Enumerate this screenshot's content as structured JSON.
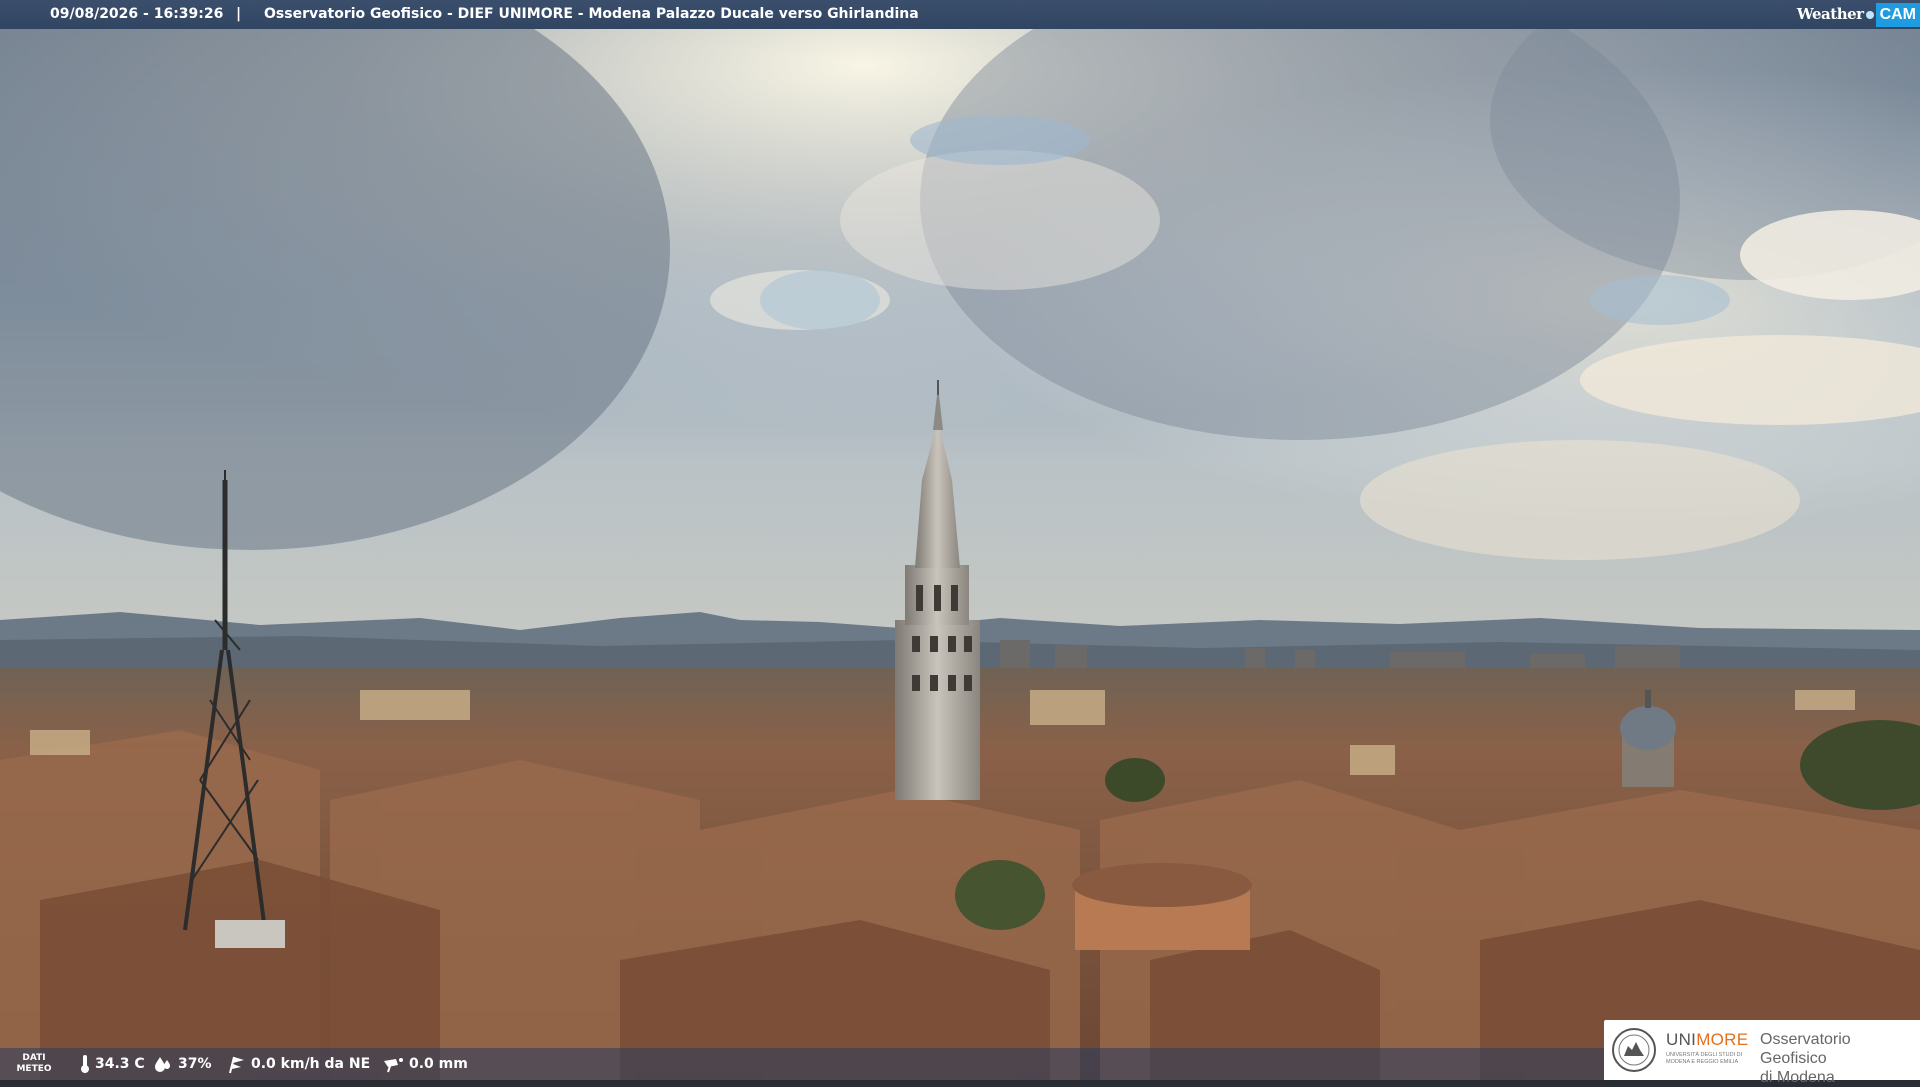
{
  "header": {
    "timestamp": "09/08/2026 - 16:39:26",
    "separator": "|",
    "title": "Osservatorio Geofisico - DIEF UNIMORE - Modena Palazzo Ducale verso Ghirlandina",
    "brand_word": "Weather",
    "brand_cam": "CAM"
  },
  "weather": {
    "label": "DATI METEO",
    "temperature": "34.3 C",
    "humidity": "37%",
    "wind": "0.0 km/h da NE",
    "rain": "0.0 mm",
    "icons": [
      "thermometer-icon",
      "humidity-icon",
      "wind-icon",
      "rain-gauge-icon"
    ]
  },
  "logo": {
    "uni_a": "UNI",
    "uni_b": "MORE",
    "uni_sub": "UNIVERSITÀ DEGLI STUDI DI MODENA E REGGIO EMILIA",
    "obs_line1": "Osservatorio Geofisico",
    "obs_line2": "di Modena"
  },
  "colors": {
    "bar": "#34496a",
    "brand_accent": "#1f9be0",
    "unimore_orange": "#e3701e",
    "sky": "#8fa3b5",
    "roofs": "#8a5a40"
  }
}
